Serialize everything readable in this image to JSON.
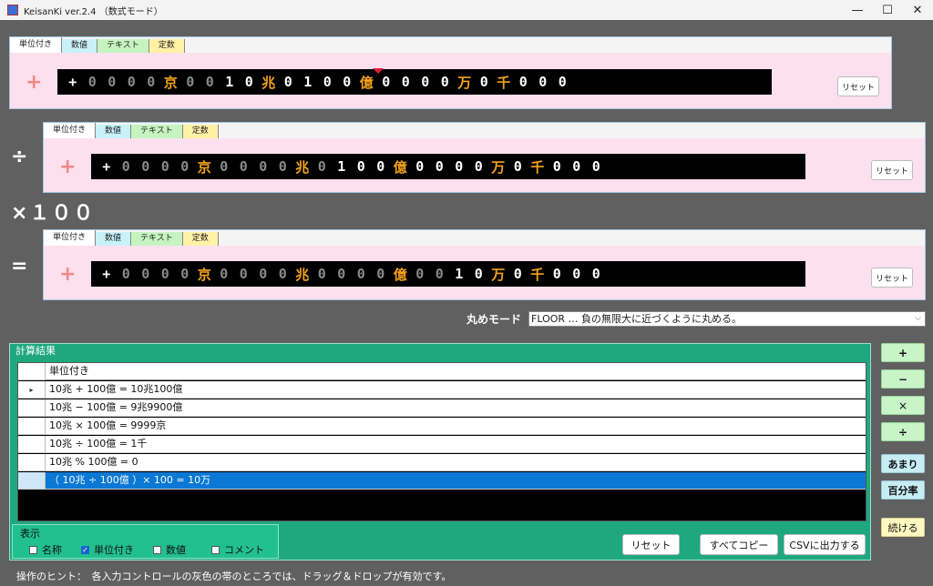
{
  "window": {
    "title": "KeisanKi  ver.2.4  （数式モード）",
    "minimize": "—",
    "maximize": "☐",
    "close": "✕"
  },
  "tabs": [
    "単位付き",
    "数値",
    "テキスト",
    "定数"
  ],
  "panels": [
    {
      "sign": "+",
      "display": [
        "+",
        "0",
        "0",
        "0",
        "0",
        "京",
        "0",
        "0",
        "1",
        "0",
        "兆",
        "0",
        "1",
        "0",
        "0",
        "億",
        "0",
        "0",
        "0",
        "0",
        "万",
        "0",
        "千",
        "0",
        "0",
        "0"
      ],
      "reset": "リセット"
    },
    {
      "sign": "+",
      "display": [
        "+",
        "0",
        "0",
        "0",
        "0",
        "京",
        "0",
        "0",
        "0",
        "0",
        "兆",
        "0",
        "1",
        "0",
        "0",
        "億",
        "0",
        "0",
        "0",
        "0",
        "万",
        "0",
        "千",
        "0",
        "0",
        "0"
      ],
      "reset": "リセット"
    },
    {
      "sign": "+",
      "display": [
        "+",
        "0",
        "0",
        "0",
        "0",
        "京",
        "0",
        "0",
        "0",
        "0",
        "兆",
        "0",
        "0",
        "0",
        "0",
        "億",
        "0",
        "0",
        "1",
        "0",
        "万",
        "0",
        "千",
        "0",
        "0",
        "0"
      ],
      "reset": "リセット"
    }
  ],
  "operators": {
    "divide": "÷",
    "multiply": "×１００",
    "equals": "="
  },
  "rounding": {
    "label": "丸めモード",
    "value": "FLOOR  …  負の無限大に近づくように丸める。"
  },
  "results": {
    "title": "計算結果",
    "header": "単位付き",
    "rows": [
      "10兆 + 100億 = 10兆100億",
      "10兆 − 100億 = 9兆9900億",
      "10兆 × 100億 = 9999京",
      "10兆 ÷ 100億 = 1千",
      "10兆 % 100億 = 0",
      "（ 10兆 ÷ 100億 ）× 100 = 10万"
    ],
    "selected_index": 5
  },
  "display_options": {
    "title": "表示",
    "items": [
      {
        "label": "名称",
        "checked": false
      },
      {
        "label": "単位付き",
        "checked": true
      },
      {
        "label": "数値",
        "checked": false
      },
      {
        "label": "コメント",
        "checked": false
      }
    ]
  },
  "buttons": {
    "reset": "リセット",
    "copy_all": "すべてコピー",
    "csv": "CSVに出力する"
  },
  "op_buttons": {
    "plus": "+",
    "minus": "−",
    "times": "×",
    "div": "÷",
    "remainder": "あまり",
    "percent": "百分率",
    "continue": "続ける"
  },
  "hint": "操作のヒント：　各入力コントロールの灰色の帯のところでは、ドラッグ＆ドロップが有効です。",
  "colors": {
    "panel_bg": "#fde0ee",
    "result_bg": "#1fa87e",
    "unit_digit": "#f4a21b",
    "selected_row": "#0a78d4"
  }
}
